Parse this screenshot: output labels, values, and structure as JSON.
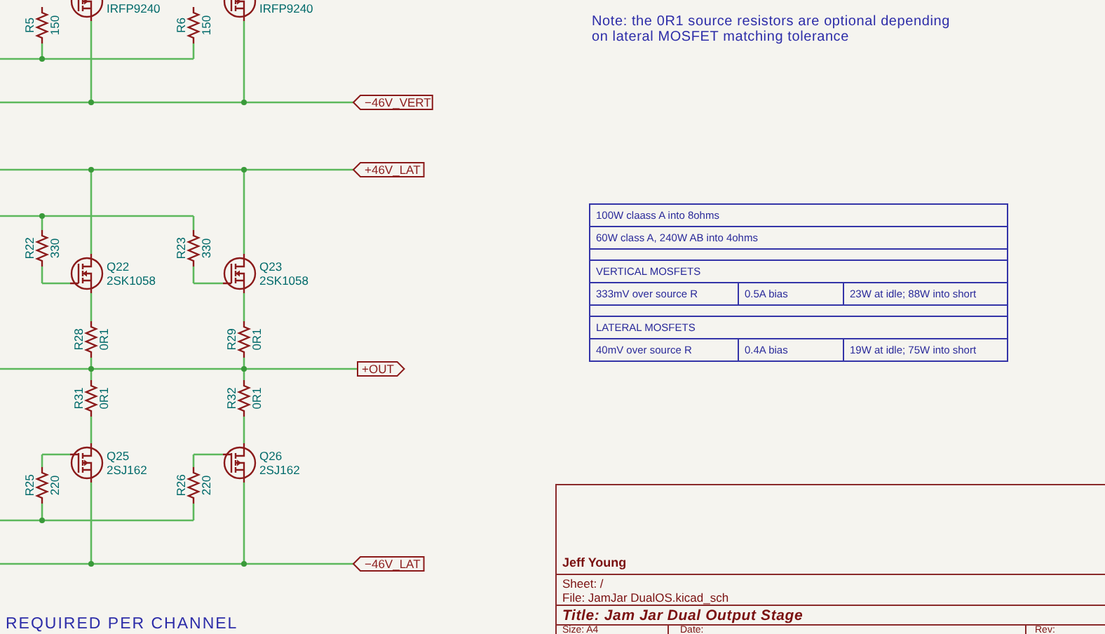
{
  "schematic": {
    "symbols": [
      {
        "kind": "resistor",
        "ref": "R5",
        "value": "150"
      },
      {
        "kind": "pmos",
        "value": "IRFP9240"
      },
      {
        "kind": "resistor",
        "ref": "R6",
        "value": "150"
      },
      {
        "kind": "pmos",
        "value": "IRFP9240"
      },
      {
        "kind": "resistor",
        "ref": "R22",
        "value": "330"
      },
      {
        "kind": "nmos",
        "ref": "Q22",
        "value": "2SK1058"
      },
      {
        "kind": "resistor",
        "ref": "R23",
        "value": "330"
      },
      {
        "kind": "nmos",
        "ref": "Q23",
        "value": "2SK1058"
      },
      {
        "kind": "resistor",
        "ref": "R28",
        "value": "0R1"
      },
      {
        "kind": "resistor",
        "ref": "R29",
        "value": "0R1"
      },
      {
        "kind": "resistor",
        "ref": "R31",
        "value": "0R1"
      },
      {
        "kind": "resistor",
        "ref": "R32",
        "value": "0R1"
      },
      {
        "kind": "pmos",
        "ref": "Q25",
        "value": "2SJ162"
      },
      {
        "kind": "pmos",
        "ref": "Q26",
        "value": "2SJ162"
      },
      {
        "kind": "resistor",
        "ref": "R25",
        "value": "220"
      },
      {
        "kind": "resistor",
        "ref": "R26",
        "value": "220"
      }
    ],
    "net_labels": [
      {
        "text": "−46V_VERT",
        "kind": "input"
      },
      {
        "text": "+46V_LAT",
        "kind": "input"
      },
      {
        "text": "+OUT",
        "kind": "output"
      },
      {
        "text": "−46V_LAT",
        "kind": "input"
      }
    ],
    "footer_note": "REQUIRED PER CHANNEL"
  },
  "note": "Note: the 0R1 source resistors are optional depending\non lateral MOSFET matching tolerance",
  "notes_table": {
    "rows": [
      {
        "kind": "single",
        "text": "100W claass A into 8ohms"
      },
      {
        "kind": "single",
        "text": "60W class A, 240W AB into 4ohms"
      },
      {
        "kind": "spacer"
      },
      {
        "kind": "single",
        "text": "VERTICAL MOSFETS"
      },
      {
        "kind": "split",
        "cells": [
          "333mV over source R",
          "0.5A bias",
          "23W at idle; 88W into short"
        ]
      },
      {
        "kind": "spacer"
      },
      {
        "kind": "single",
        "text": "LATERAL MOSFETS"
      },
      {
        "kind": "split",
        "cells": [
          "40mV over source R",
          "0.4A bias",
          "19W at idle; 75W into short"
        ]
      }
    ]
  },
  "title_block": {
    "company": "Jeff Young",
    "sheet": "Sheet: /",
    "file": "File: JamJar DualOS.kicad_sch",
    "title": "Title: Jam Jar Dual Output Stage",
    "size": "Size: A4",
    "date": "Date:",
    "rev": "Rev:"
  }
}
